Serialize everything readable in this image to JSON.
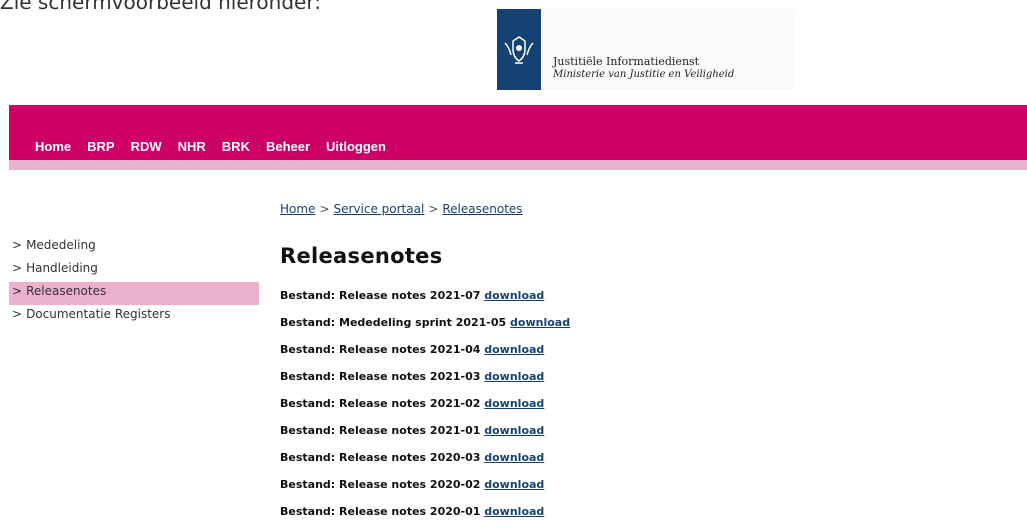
{
  "intro_text": "Zie schermvoorbeeld hieronder:",
  "logo": {
    "title": "Justitiële Informatiedienst",
    "subtitle": "Ministerie van Justitie en Veiligheid",
    "emblem_color": "#154273"
  },
  "colors": {
    "brand": "#cc0066",
    "brand_light": "#eab2cd",
    "link": "#154273"
  },
  "nav": {
    "items": [
      "Home",
      "BRP",
      "RDW",
      "NHR",
      "BRK",
      "Beheer",
      "Uitloggen"
    ]
  },
  "breadcrumb": {
    "items": [
      "Home",
      "Service portaal",
      "Releasenotes"
    ],
    "separator": ">"
  },
  "sidebar": {
    "chevron": ">",
    "items": [
      {
        "label": "Mededeling"
      },
      {
        "label": "Handleiding"
      },
      {
        "label": "Releasenotes",
        "active": true
      },
      {
        "label": "Documentatie Registers"
      }
    ]
  },
  "main": {
    "title": "Releasenotes",
    "files": [
      {
        "label": "Bestand: Release notes 2021-07",
        "link": "download"
      },
      {
        "label": "Bestand: Mededeling sprint 2021-05",
        "link": "download"
      },
      {
        "label": "Bestand: Release notes 2021-04",
        "link": "download"
      },
      {
        "label": "Bestand: Release notes 2021-03",
        "link": "download"
      },
      {
        "label": "Bestand: Release notes 2021-02",
        "link": "download"
      },
      {
        "label": "Bestand: Release notes 2021-01",
        "link": "download"
      },
      {
        "label": "Bestand: Release notes 2020-03",
        "link": "download"
      },
      {
        "label": "Bestand: Release notes 2020-02",
        "link": "download"
      },
      {
        "label": "Bestand: Release notes 2020-01",
        "link": "download"
      }
    ]
  }
}
